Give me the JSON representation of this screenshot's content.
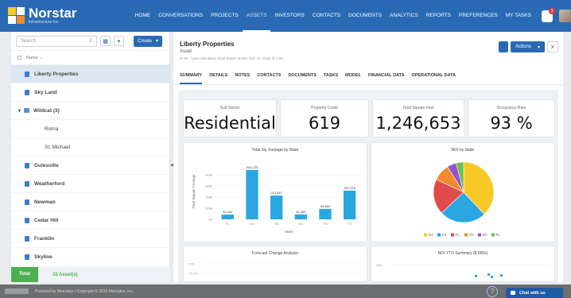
{
  "brand": {
    "name": "Norstar",
    "subtitle": "Infrastructure Inc."
  },
  "nav": [
    "HOME",
    "CONVERSATIONS",
    "PROJECTS",
    "ASSETS",
    "INVESTORS",
    "CONTACTS",
    "DOCUMENTS",
    "ANALYTICS",
    "REPORTS",
    "PREFERENCES",
    "MY TASKS"
  ],
  "nav_active_index": 3,
  "notifications": {
    "count": "3"
  },
  "sidebar": {
    "search_placeholder": "Search",
    "create_label": "Create",
    "column_header": "Name",
    "items": [
      {
        "label": "Liberty Properties",
        "kind": "item",
        "selected": true
      },
      {
        "label": "Sky Land",
        "kind": "item"
      },
      {
        "label": "Wildcat (3)",
        "kind": "folder"
      },
      {
        "label": "Roma",
        "kind": "child"
      },
      {
        "label": "St. Michael",
        "kind": "child"
      },
      {
        "label": "Gulesville",
        "kind": "item"
      },
      {
        "label": "Weatherford",
        "kind": "item"
      },
      {
        "label": "Newman",
        "kind": "item"
      },
      {
        "label": "Cedar Hill",
        "kind": "item"
      },
      {
        "label": "Franklin",
        "kind": "item"
      },
      {
        "label": "Skyline",
        "kind": "item"
      }
    ],
    "total_label": "Total",
    "total_value": "33 Asset(s)"
  },
  "asset": {
    "title": "Liberty Properties",
    "type": "Asset",
    "meta": "ID:84 , Last Calculated: Real Estate Model, Dec 10, 2018 @ 1:04",
    "actions_label": "Actions"
  },
  "tabs": [
    "SUMMARY",
    "DETAILS",
    "NOTES",
    "CONTACTS",
    "DOCUMENTS",
    "TASKS",
    "MODEL",
    "FINANCIAL DATA",
    "OPERATIONAL DATA"
  ],
  "kpis": [
    {
      "label": "Sub Sector",
      "value": "Residential"
    },
    {
      "label": "Property Count",
      "value": "619"
    },
    {
      "label": "Total Square Feet",
      "value": "1,246,653"
    },
    {
      "label": "Occupancy Rate",
      "value": "93 %"
    }
  ],
  "chart_data": [
    {
      "type": "bar",
      "title": "Total Sq. Footage by State",
      "xlabel": "State",
      "ylabel": "Total Square Footage",
      "categories": [
        "FL",
        "GA",
        "TN",
        "NC",
        "TN",
        "TX"
      ],
      "values": [
        42191,
        443723,
        213457,
        44205,
        93462,
        257976
      ],
      "value_labels": [
        "42,191",
        "443,723",
        "213,457",
        "44,205",
        "93,462",
        "257,976"
      ],
      "y_ticks": [
        "0k",
        "100k",
        "200k",
        "300k",
        "400k"
      ],
      "ylim": [
        0,
        500000
      ],
      "color": "#2aa7e0"
    },
    {
      "type": "pie",
      "title": "NOI by State",
      "legend_position": "bottom",
      "slices": [
        {
          "name": "GA",
          "value": 38,
          "color": "#f7c928"
        },
        {
          "name": "TX",
          "value": 25,
          "color": "#2aa7e0"
        },
        {
          "name": "FL",
          "value": 19,
          "color": "#e04b4b"
        },
        {
          "name": "TN",
          "value": 9,
          "color": "#f08a2a"
        },
        {
          "name": "NC",
          "value": 5,
          "color": "#9b51c8"
        },
        {
          "name": "PL",
          "value": 4,
          "color": "#6cc04a"
        }
      ]
    },
    {
      "type": "line",
      "title": "Forecast Change Analysis",
      "y_ticks": [
        "20%",
        "17.5%"
      ]
    },
    {
      "type": "scatter",
      "title": "NOI YTD Summary ($ 000s)",
      "y_ticks": [
        "400"
      ],
      "color": "#2aa7e0"
    }
  ],
  "footer": {
    "text": "Powered by Mercatus | Copyright © 2016 Mercatus, Inc."
  },
  "chat_label": "Chat with us",
  "help_label": "?"
}
